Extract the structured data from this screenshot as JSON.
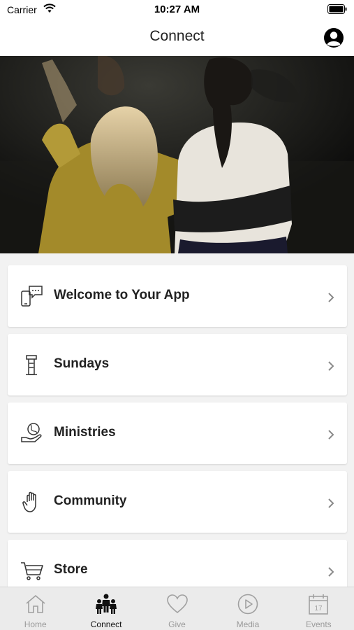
{
  "status_bar": {
    "carrier": "Carrier",
    "time": "10:27 AM"
  },
  "nav": {
    "title": "Connect"
  },
  "menu": {
    "items": [
      {
        "label": "Welcome to Your App",
        "icon": "phone-chat-icon"
      },
      {
        "label": "Sundays",
        "icon": "pulpit-icon"
      },
      {
        "label": "Ministries",
        "icon": "globe-hand-icon"
      },
      {
        "label": "Community",
        "icon": "raised-hand-icon"
      },
      {
        "label": "Store",
        "icon": "cart-icon"
      }
    ]
  },
  "tabs": [
    {
      "label": "Home",
      "icon": "home-icon",
      "active": false
    },
    {
      "label": "Connect",
      "icon": "people-icon",
      "active": true
    },
    {
      "label": "Give",
      "icon": "heart-icon",
      "active": false
    },
    {
      "label": "Media",
      "icon": "play-circle-icon",
      "active": false
    },
    {
      "label": "Events",
      "icon": "calendar-icon",
      "active": false
    }
  ],
  "calendar_day": "17",
  "colors": {
    "background": "#f2f2f2",
    "card": "#ffffff",
    "tab_bar": "#ebebeb",
    "tab_inactive": "#9a9a9a",
    "tab_active": "#111111"
  }
}
